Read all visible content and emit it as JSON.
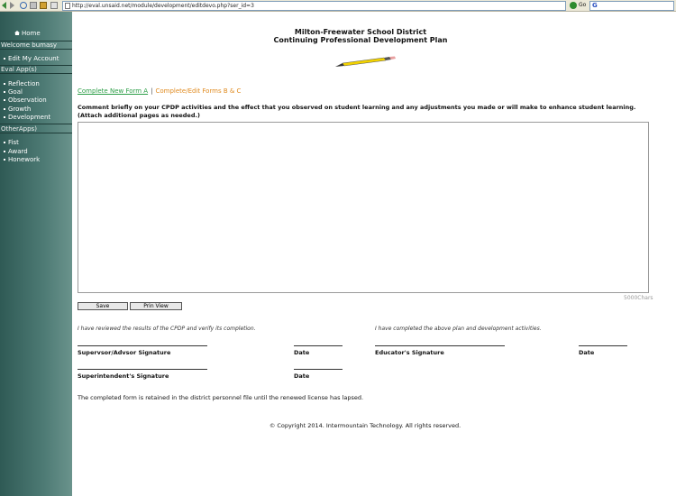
{
  "browser": {
    "url": "http://eval.unsaid.net/module/development/editdevo.php?ser_id=3",
    "go_label": "Go",
    "search_logo": "G"
  },
  "sidebar": {
    "home": "Home",
    "welcome": "Welcome bumasy",
    "edit_account": "Edit My Account",
    "eval_apps_header": "Eval App(s)",
    "eval_apps": [
      "Reflection",
      "Goal",
      "Observation",
      "Growth",
      "Development"
    ],
    "other_apps_header": "OtherApps)",
    "other_apps": [
      "Fist",
      "Award",
      "Honework"
    ]
  },
  "header": {
    "title_line1": "Milton-Freewater School District",
    "title_line2": "Continuing Professional Development Plan"
  },
  "nav": {
    "link1": "Complete New Form A",
    "separator": "|",
    "link2": "Complete/Edit Forms B & C"
  },
  "form": {
    "instructions": "Comment briefly on your CPDP activities and the effect that you observed on student learning and any adjustments you made or will make to enhance student learning. (Attach additional pages as needed.)",
    "comment_value": "",
    "char_count": "5000Chars",
    "save_label": "Save",
    "print_label": "Prin View"
  },
  "signatures": {
    "left_note": "I have reviewed the results of the CPDP and verify its completion.",
    "right_note": "I have completed the above plan and development activities.",
    "supervisor_label": "Supervsor/Advsor Signature",
    "date_label": "Date",
    "superintendent_label": "Superintendent's Signature",
    "educator_label": "Educator's Signature"
  },
  "footer": {
    "note": "The completed form is retained in the district personnel file until the renewed license has lapsed.",
    "copyright": "© Copyright 2014. Intermountain Technology. All rights reserved."
  },
  "colors": {
    "sidebar": "#3d6b66",
    "link_green": "#2a9d45",
    "link_orange": "#e08a1e"
  }
}
